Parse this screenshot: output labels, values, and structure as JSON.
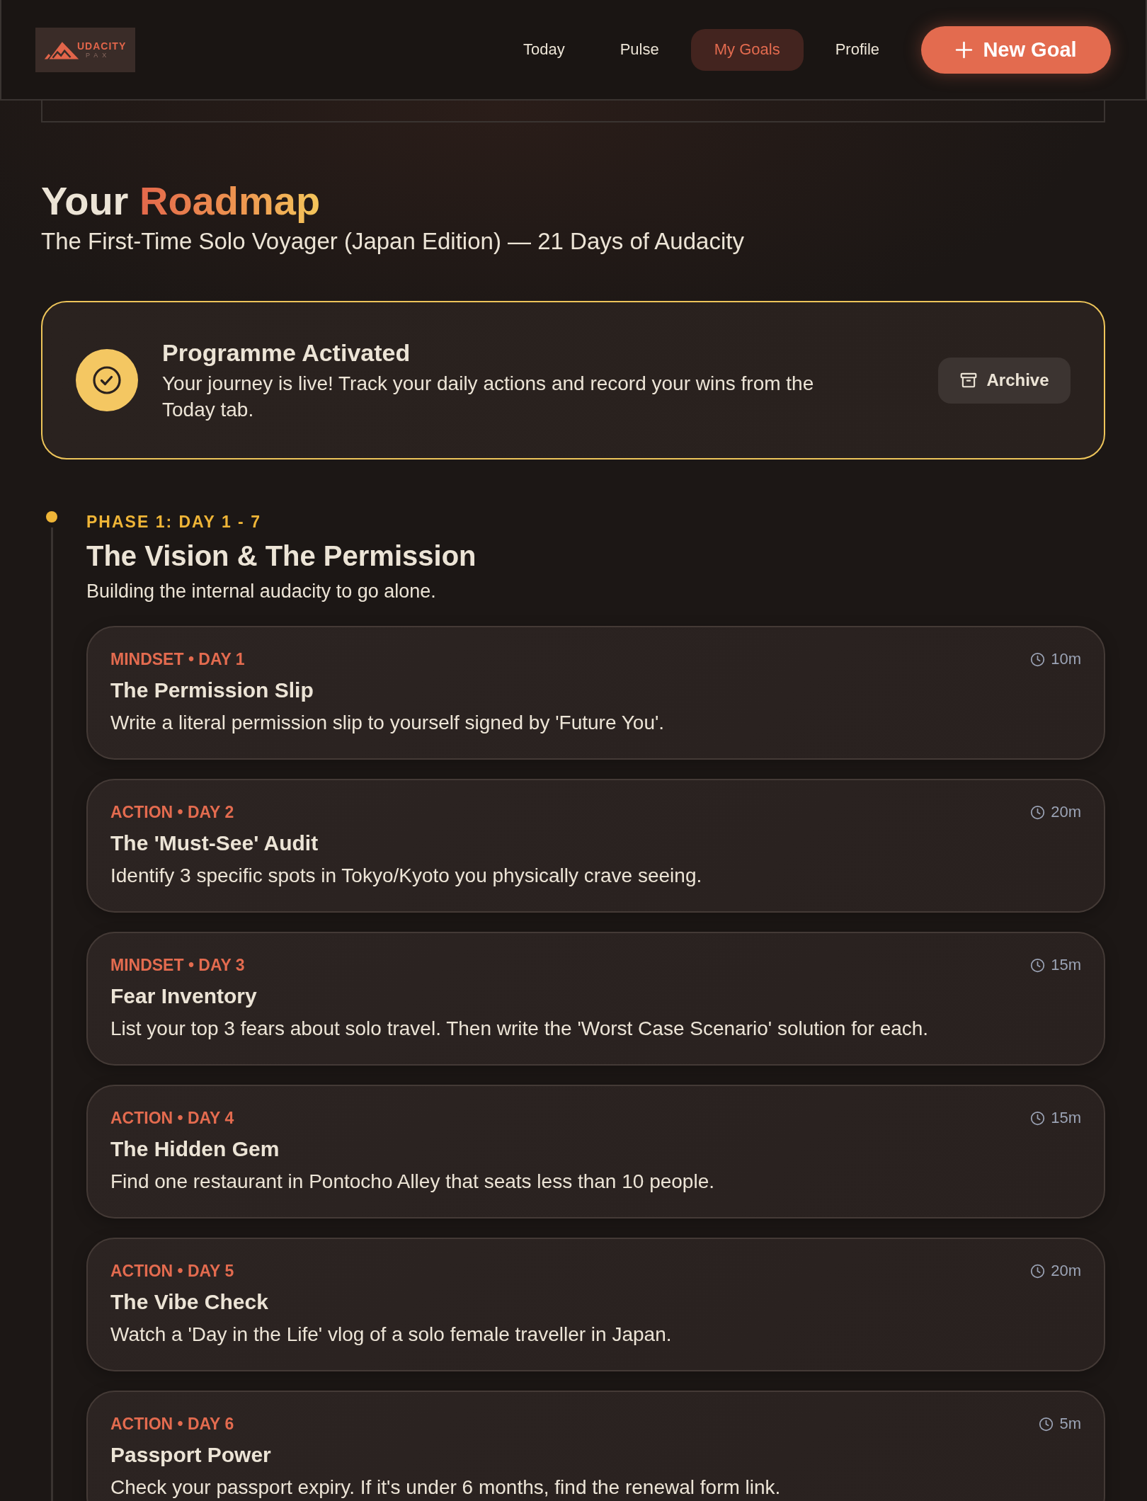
{
  "logo": {
    "wordmark": "UDACITY",
    "tagline": "PAX"
  },
  "nav": {
    "tabs": [
      {
        "label": "Today",
        "selected": false
      },
      {
        "label": "Pulse",
        "selected": false
      },
      {
        "label": "My Goals",
        "selected": true
      },
      {
        "label": "Profile",
        "selected": false
      }
    ],
    "new_goal_button": "New Goal"
  },
  "page": {
    "title": {
      "text": "Your",
      "highlight": "Roadmap"
    },
    "subtitle": "The First-Time Solo Voyager (Japan Edition) — 21 Days of Audacity"
  },
  "banner": {
    "title": "Programme Activated",
    "message": "Your journey is live! Track your daily actions and record your wins from the Today tab.",
    "button": "Archive"
  },
  "phases": [
    {
      "label": "PHASE 1: DAY 1 - 7",
      "title": "The Vision & The Permission",
      "description": "Building the internal audacity to go alone.",
      "tasks": [
        {
          "tag": "MINDSET • DAY 1",
          "title": "The Permission Slip",
          "description": "Write a literal permission slip to yourself signed by 'Future You'.",
          "duration": "10m"
        },
        {
          "tag": "ACTION • DAY 2",
          "title": "The 'Must-See' Audit",
          "description": "Identify 3 specific spots in Tokyo/Kyoto you physically crave seeing.",
          "duration": "20m"
        },
        {
          "tag": "MINDSET • DAY 3",
          "title": "Fear Inventory",
          "description": "List your top 3 fears about solo travel. Then write the 'Worst Case Scenario' solution for each.",
          "duration": "15m"
        },
        {
          "tag": "ACTION • DAY 4",
          "title": "The Hidden Gem",
          "description": "Find one restaurant in Pontocho Alley that seats less than 10 people.",
          "duration": "15m"
        },
        {
          "tag": "ACTION • DAY 5",
          "title": "The Vibe Check",
          "description": "Watch a 'Day in the Life' vlog of a solo female traveller in Japan.",
          "duration": "20m"
        },
        {
          "tag": "ACTION • DAY 6",
          "title": "Passport Power",
          "description": "Check your passport expiry. If it's under 6 months, find the renewal form link.",
          "duration": "5m"
        }
      ]
    }
  ]
}
